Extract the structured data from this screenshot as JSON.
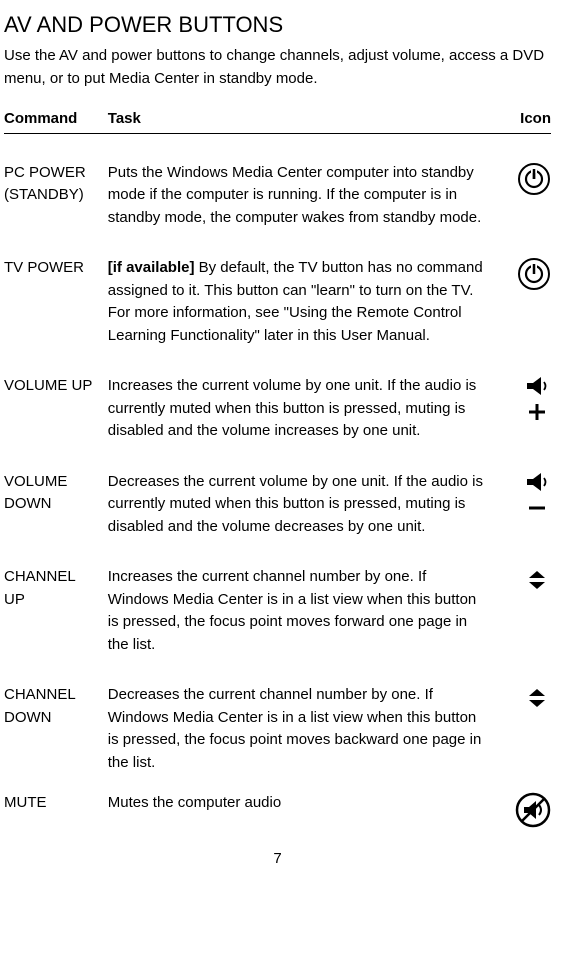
{
  "title": "AV AND POWER BUTTONS",
  "intro": "Use the AV and power buttons to change channels, adjust volume, access a DVD menu, or to put Media Center in standby mode.",
  "headers": {
    "command": "Command",
    "task": "Task",
    "icon": "Icon"
  },
  "rows": [
    {
      "command": "PC POWER (STANDBY)",
      "task": "Puts the Windows Media Center computer into standby mode if the computer is running. If the computer is in standby mode, the computer wakes from standby mode.",
      "icon": "power-icon"
    },
    {
      "command": "TV POWER",
      "task_prefix_bold": "[if available]",
      "task": " By default, the TV button has no command assigned to it. This button can \"learn\" to turn on the TV. For more information, see \"Using the Remote Control Learning Functionality\" later in this User Manual.",
      "icon": "power-icon"
    },
    {
      "command": "VOLUME UP",
      "task": "Increases the current volume by one unit. If the audio is currently muted when this button is pressed, muting is disabled and the volume increases by one unit.",
      "icon": "volume-up-icon"
    },
    {
      "command": "VOLUME DOWN",
      "task": "Decreases the current volume by one unit. If the audio is currently muted when this button is pressed, muting is disabled and the volume decreases by one unit.",
      "icon": "volume-down-icon"
    },
    {
      "command": "CHANNEL UP",
      "task": "Increases the current channel number by one. If Windows Media Center is in a list view when this button is pressed, the focus point moves forward one page in the list.",
      "icon": "channel-icon"
    },
    {
      "command": "CHANNEL DOWN",
      "task": "Decreases the current channel number by one. If Windows Media Center is in a list view when this button is pressed, the focus point moves backward one page in the list.",
      "icon": "channel-icon"
    },
    {
      "command": "MUTE",
      "task": "Mutes the computer audio",
      "icon": "mute-icon"
    }
  ],
  "page_number": "7"
}
